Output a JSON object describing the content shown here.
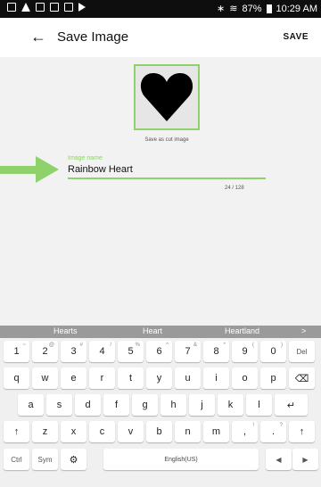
{
  "status_bar": {
    "battery": "87%",
    "time": "10:29 AM"
  },
  "app_bar": {
    "back_icon": "arrow-left-icon",
    "title": "Save Image",
    "save_label": "SAVE"
  },
  "preview": {
    "shape": "heart-shape",
    "caption": "Save as cut image"
  },
  "name_field": {
    "label": "Image name",
    "value": "Rainbow Heart",
    "counter": "24 / 128"
  },
  "suggestions": [
    "Hearts",
    "Heart",
    "Heartland",
    ">"
  ],
  "keyboard": {
    "number_row": [
      {
        "main": "1",
        "sup": "~"
      },
      {
        "main": "2",
        "sup": "@"
      },
      {
        "main": "3",
        "sup": "#"
      },
      {
        "main": "4",
        "sup": "/"
      },
      {
        "main": "5",
        "sup": "%"
      },
      {
        "main": "6",
        "sup": "^"
      },
      {
        "main": "7",
        "sup": "&"
      },
      {
        "main": "8",
        "sup": "*"
      },
      {
        "main": "9",
        "sup": "("
      },
      {
        "main": "0",
        "sup": ")"
      },
      {
        "main": "Del",
        "sup": ""
      }
    ],
    "row1": [
      "q",
      "w",
      "e",
      "r",
      "t",
      "y",
      "u",
      "i",
      "o",
      "p",
      "⌫"
    ],
    "row2": [
      "a",
      "s",
      "d",
      "f",
      "g",
      "h",
      "j",
      "k",
      "l",
      "↵"
    ],
    "row3": [
      "↑",
      "z",
      "x",
      "c",
      "v",
      "b",
      "n",
      "m",
      ",",
      ".",
      "↑"
    ],
    "row3_sup": {
      "8": "!",
      "9": "?"
    },
    "bottom": {
      "ctrl": "Ctrl",
      "sym": "Sym",
      "settings_icon": "gear-icon",
      "space": "English(US)",
      "left": "◀",
      "right": "▶"
    }
  },
  "colors": {
    "accent": "#8fd16a",
    "status_bar": "#0e0e0e",
    "content_bg": "#f2f2f2",
    "suggest_bar": "#9a9a9a"
  }
}
